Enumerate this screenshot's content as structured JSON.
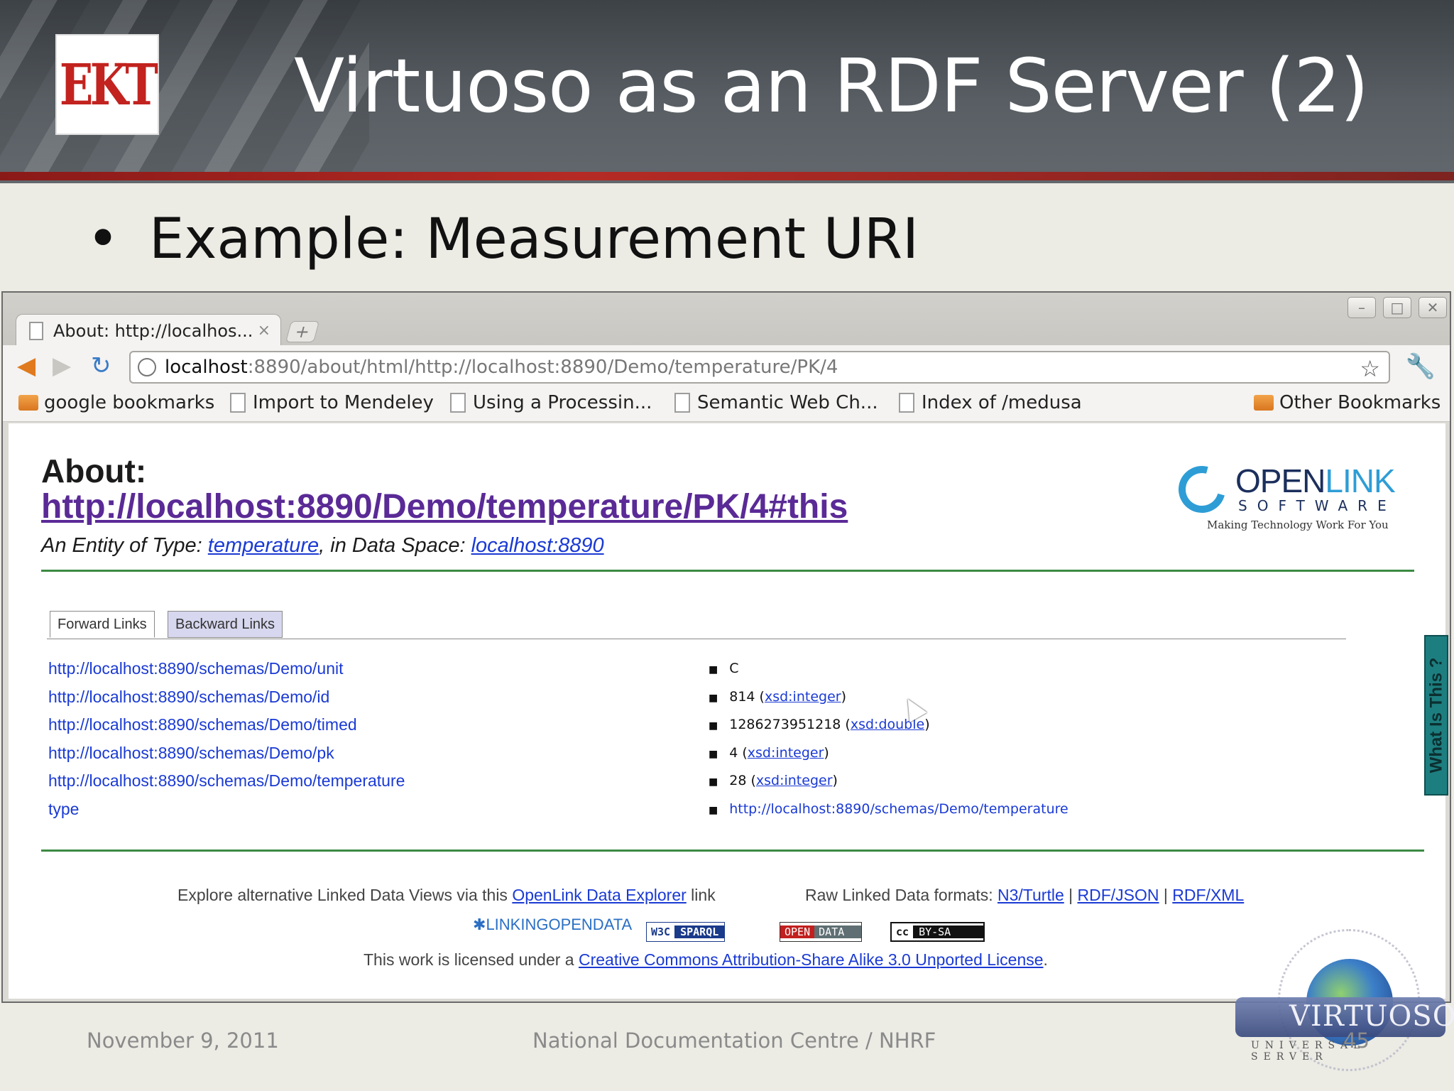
{
  "slide": {
    "logo_text": "EKT",
    "title": "Virtuoso as an RDF Server (2)",
    "bullet": "•",
    "bullet_text": "Example: Measurement URI",
    "footer_date": "November 9, 2011",
    "footer_org": "National Documentation Centre / NHRF",
    "page_number": "45"
  },
  "browser": {
    "tab_label": "About: http://localhos...",
    "tab_close": "×",
    "new_tab": "+",
    "window_buttons": [
      "–",
      "□",
      "✕"
    ],
    "url_host": "localhost",
    "url_path": ":8890/about/html/http://localhost:8890/Demo/temperature/PK/4",
    "bookmarks": [
      {
        "label": "google bookmarks",
        "icon": "folder"
      },
      {
        "label": "Import to Mendeley",
        "icon": "page"
      },
      {
        "label": "Using a Processin...",
        "icon": "page"
      },
      {
        "label": "Semantic Web Ch...",
        "icon": "page"
      },
      {
        "label": "Index of /medusa",
        "icon": "page"
      },
      {
        "label": "Other Bookmarks",
        "icon": "folder"
      }
    ]
  },
  "page": {
    "about_label": "About:",
    "about_uri": "http://localhost:8890/Demo/temperature/PK/4#this",
    "entity_prefix": "An Entity of Type: ",
    "entity_type": "temperature",
    "entity_mid": ", in Data Space: ",
    "data_space": "localhost:8890",
    "openlink": {
      "open": "OPEN",
      "link": "LINK",
      "software": "SOFTWARE",
      "tagline": "Making Technology Work For You"
    },
    "tabs": {
      "forward": "Forward Links",
      "backward": "Backward Links"
    },
    "rows": [
      {
        "property": "http://localhost:8890/schemas/Demo/unit",
        "value": "C",
        "type": ""
      },
      {
        "property": "http://localhost:8890/schemas/Demo/id",
        "value": "814",
        "type": "xsd:integer"
      },
      {
        "property": "http://localhost:8890/schemas/Demo/timed",
        "value": "1286273951218",
        "type": "xsd:double"
      },
      {
        "property": "http://localhost:8890/schemas/Demo/pk",
        "value": "4",
        "type": "xsd:integer"
      },
      {
        "property": "http://localhost:8890/schemas/Demo/temperature",
        "value": "28",
        "type": "xsd:integer"
      },
      {
        "property": "type",
        "value": "http://localhost:8890/schemas/Demo/temperature",
        "type": ""
      }
    ],
    "explore_prefix": "Explore alternative Linked Data Views via this ",
    "explore_link": "OpenLink Data Explorer",
    "explore_suffix": " link",
    "raw_prefix": "Raw Linked Data formats: ",
    "raw_formats": [
      "N3/Turtle",
      "RDF/JSON",
      "RDF/XML"
    ],
    "raw_sep": "|",
    "badges": {
      "lod": "LINKINGOPENDATA",
      "w3c": "W3C",
      "sparql": "SPARQL",
      "open": "OPEN",
      "data": "DATA",
      "cc": "cc",
      "bysa": "BY-SA"
    },
    "license_prefix": "This work is licensed under a ",
    "license_link": "Creative Commons Attribution-Share Alike 3.0 Unported License",
    "license_suffix": ".",
    "side_tab": "What Is This ?"
  },
  "virtuoso": {
    "name": "VIRTUOSO",
    "sub": "UNIVERSAL SERVER"
  }
}
